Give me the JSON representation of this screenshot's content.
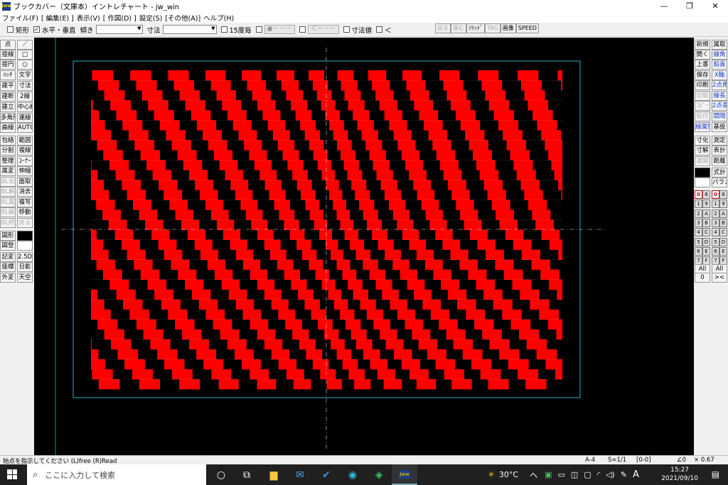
{
  "window": {
    "title": "ブックカバー（文庫本）イントレチャート - jw_win",
    "app_icon_text": "Jww",
    "minimize": "—",
    "maximize": "❐",
    "close": "✕"
  },
  "menu": [
    "ファイル(F)",
    "[ 編集(E) ]",
    "表示(V)",
    "[ 作図(D) ]",
    "設定(S)",
    "[その他(A)]",
    "ヘルプ(H)"
  ],
  "toolbar": {
    "rect_label": "矩形",
    "hv_label": "水平・垂直",
    "hv_checked": "✓",
    "tilt_label": "傾き",
    "dim_label": "寸法",
    "deg15_label": "15度毎",
    "circle_field": "●－－－",
    "arrow_field": "＜－－－",
    "dimval_label": "寸法値",
    "lt_label": "＜",
    "right_buttons": [
      "戻る",
      "進む",
      "ｿﾘｯﾄﾞ",
      "TAG",
      "画像",
      "SPEED"
    ]
  },
  "left_panel": [
    [
      "点",
      "／"
    ],
    [
      "接線",
      "□"
    ],
    [
      "接円",
      "○"
    ],
    [
      "ﾊｯﾁ",
      "文字"
    ],
    [
      "建平",
      "寸法"
    ],
    [
      "建断",
      "2線"
    ],
    [
      "建立",
      "中心線"
    ],
    [
      "多角形",
      "連線"
    ],
    [
      "曲線",
      "AUTO"
    ],
    [
      "包絡",
      "範囲"
    ],
    [
      "分割",
      "複線"
    ],
    [
      "整理",
      "ｺｰﾅｰ"
    ],
    [
      "属変",
      "伸縮"
    ],
    [
      "BL化",
      "面取"
    ],
    [
      "BL解",
      "消去"
    ],
    [
      "BL属",
      "複写"
    ],
    [
      "BL編",
      "移動"
    ],
    [
      "BL終",
      "戻る"
    ],
    [
      "図形",
      ""
    ],
    [
      "図登",
      ""
    ],
    [
      "記変",
      "2.5D"
    ],
    [
      "座標",
      "日影"
    ],
    [
      "外変",
      "天空"
    ]
  ],
  "right_panel": [
    [
      "新規",
      "属取"
    ],
    [
      "開く",
      "線角"
    ],
    [
      "上書",
      "鉛直"
    ],
    [
      "保存",
      "X軸"
    ],
    [
      "印刷",
      "2点角"
    ],
    [
      "切取",
      "線長"
    ],
    [
      "ｺﾋﾟｰ",
      "2点長"
    ],
    [
      "貼付",
      "間隔"
    ],
    [
      "線属性",
      "基設"
    ],
    [
      "寸化",
      "測定"
    ],
    [
      "寸解",
      "表計"
    ],
    [
      "選図",
      "距離"
    ],
    [
      "",
      "式計"
    ],
    [
      "",
      "パラメ"
    ]
  ],
  "layers": {
    "left": [
      "0",
      "1",
      "2",
      "3",
      "4",
      "5",
      "6",
      "7"
    ],
    "left_hex": [
      "8",
      "9",
      "A",
      "B",
      "C",
      "D",
      "E",
      "F"
    ],
    "all": "All",
    "bottom_left": "0",
    "bottom_right": "><"
  },
  "status": {
    "message": "始点を指示してください (L)free (R)Read",
    "paper": "A-4",
    "scale": "S=1/1",
    "layer": "[0-0]",
    "angle": "∠0",
    "zoom": "× 0.67"
  },
  "taskbar": {
    "search_placeholder": "ここに入力して検索",
    "weather": "30°C",
    "ime": "A",
    "time": "15:27",
    "date": "2021/09/10",
    "tray_chevron": "ヘ"
  },
  "colors": {
    "pattern_red": "#ff0000",
    "frame": "#1fb5c4",
    "guide": "#2a9d2a"
  }
}
